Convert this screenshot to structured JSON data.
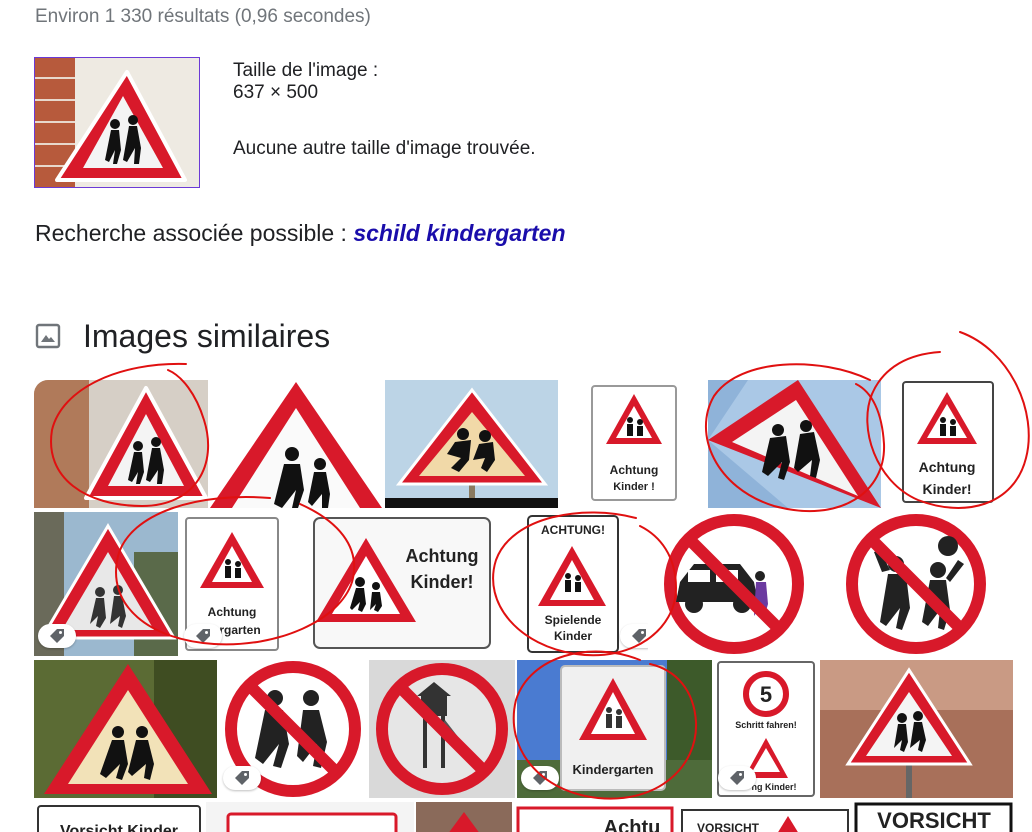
{
  "results": {
    "stats": "Environ 1 330 résultats (0,96 secondes)"
  },
  "image_info": {
    "size_label": "Taille de l'image :",
    "size_value": "637 × 500",
    "no_other_sizes": "Aucune autre taille d'image trouvée."
  },
  "related": {
    "label": "Recherche associée possible :",
    "link": "schild kindergarten"
  },
  "similar": {
    "title": "Images similaires",
    "icon": "image-icon"
  },
  "tile_texts": {
    "achtung": "Achtung",
    "kinder_bang": "Kinder !",
    "kinder_excl": "Kinder!",
    "achtung_caps": "ACHTUNG!",
    "spielende": "Spielende",
    "kinder": "Kinder",
    "kindergarten": "Kindergarten",
    "rgarten": "rgarten",
    "five": "5",
    "schritt": "Schritt fahren!",
    "ng_kinder": "ng Kinder!",
    "vorsicht": "VORSICHT",
    "vorsicht_kinder": "Vorsicht Kinder",
    "achtu": "Achtu",
    "vorsicht_small": "VORSICHT"
  },
  "colors": {
    "link": "#1a0dab",
    "sign_red": "#d8192a",
    "annotation_red": "#e01010"
  }
}
